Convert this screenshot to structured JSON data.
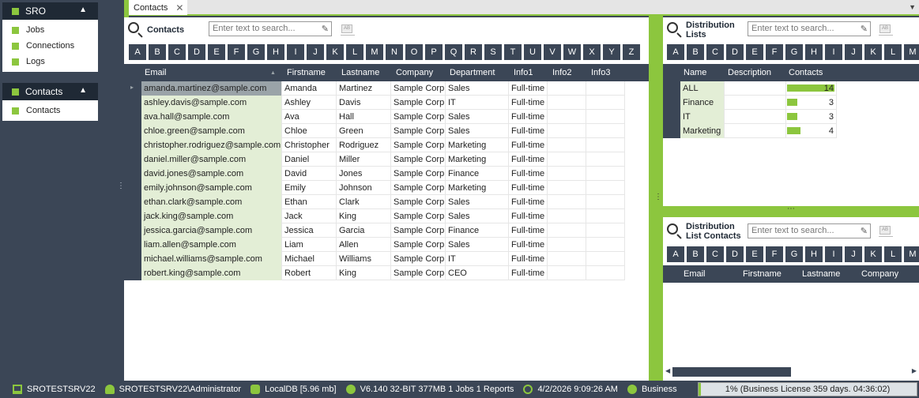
{
  "sidebar": {
    "groups": [
      {
        "title": "SRO",
        "items": [
          "Jobs",
          "Connections",
          "Logs"
        ]
      },
      {
        "title": "Contacts",
        "items": [
          "Contacts"
        ]
      }
    ]
  },
  "tabs": [
    {
      "label": "Contacts"
    }
  ],
  "contacts_panel": {
    "title": "Contacts",
    "search_placeholder": "Enter text to search...",
    "alphabet": [
      "A",
      "B",
      "C",
      "D",
      "E",
      "F",
      "G",
      "H",
      "I",
      "J",
      "K",
      "L",
      "M",
      "N",
      "O",
      "P",
      "Q",
      "R",
      "S",
      "T",
      "U",
      "V",
      "W",
      "X",
      "Y",
      "Z"
    ],
    "columns": [
      "Email",
      "Firstname",
      "Lastname",
      "Company",
      "Department",
      "Info1",
      "Info2",
      "Info3"
    ],
    "rows": [
      [
        "amanda.martinez@sample.com",
        "Amanda",
        "Martinez",
        "Sample Corp",
        "Sales",
        "Full-time",
        "",
        ""
      ],
      [
        "ashley.davis@sample.com",
        "Ashley",
        "Davis",
        "Sample Corp",
        "IT",
        "Full-time",
        "",
        ""
      ],
      [
        "ava.hall@sample.com",
        "Ava",
        "Hall",
        "Sample Corp",
        "Sales",
        "Full-time",
        "",
        ""
      ],
      [
        "chloe.green@sample.com",
        "Chloe",
        "Green",
        "Sample Corp",
        "Sales",
        "Full-time",
        "",
        ""
      ],
      [
        "christopher.rodriguez@sample.com",
        "Christopher",
        "Rodriguez",
        "Sample Corp",
        "Marketing",
        "Full-time",
        "",
        ""
      ],
      [
        "daniel.miller@sample.com",
        "Daniel",
        "Miller",
        "Sample Corp",
        "Marketing",
        "Full-time",
        "",
        ""
      ],
      [
        "david.jones@sample.com",
        "David",
        "Jones",
        "Sample Corp",
        "Finance",
        "Full-time",
        "",
        ""
      ],
      [
        "emily.johnson@sample.com",
        "Emily",
        "Johnson",
        "Sample Corp",
        "Marketing",
        "Full-time",
        "",
        ""
      ],
      [
        "ethan.clark@sample.com",
        "Ethan",
        "Clark",
        "Sample Corp",
        "Sales",
        "Full-time",
        "",
        ""
      ],
      [
        "jack.king@sample.com",
        "Jack",
        "King",
        "Sample Corp",
        "Sales",
        "Full-time",
        "",
        ""
      ],
      [
        "jessica.garcia@sample.com",
        "Jessica",
        "Garcia",
        "Sample Corp",
        "Finance",
        "Full-time",
        "",
        ""
      ],
      [
        "liam.allen@sample.com",
        "Liam",
        "Allen",
        "Sample Corp",
        "Sales",
        "Full-time",
        "",
        ""
      ],
      [
        "michael.williams@sample.com",
        "Michael",
        "Williams",
        "Sample Corp",
        "IT",
        "Full-time",
        "",
        ""
      ],
      [
        "robert.king@sample.com",
        "Robert",
        "King",
        "Sample Corp",
        "CEO",
        "Full-time",
        "",
        ""
      ]
    ]
  },
  "distribution_lists": {
    "title_line1": "Distribution",
    "title_line2": "Lists",
    "search_placeholder": "Enter text to search...",
    "alphabet": [
      "A",
      "B",
      "C",
      "D",
      "E",
      "F",
      "G",
      "H",
      "I",
      "J",
      "K",
      "L",
      "M"
    ],
    "columns": [
      "Name",
      "Description",
      "Contacts"
    ],
    "rows": [
      {
        "name": "ALL",
        "description": "",
        "contacts": 14
      },
      {
        "name": "Finance",
        "description": "",
        "contacts": 3
      },
      {
        "name": "IT",
        "description": "",
        "contacts": 3
      },
      {
        "name": "Marketing",
        "description": "",
        "contacts": 4
      }
    ]
  },
  "distribution_list_contacts": {
    "title_line1": "Distribution",
    "title_line2": "List Contacts",
    "search_placeholder": "Enter text to search...",
    "alphabet": [
      "A",
      "B",
      "C",
      "D",
      "E",
      "F",
      "G",
      "H",
      "I",
      "J",
      "K",
      "L",
      "M"
    ],
    "columns": [
      "Email",
      "Firstname",
      "Lastname",
      "Company"
    ]
  },
  "statusbar": {
    "server": "SROTESTSRV22",
    "user": "SROTESTSRV22\\Administrator",
    "db": "LocalDB [5.96 mb]",
    "version": "V6.140 32-BIT 377MB 1 Jobs 1 Reports",
    "datetime": "4/2/2026 9:09:26 AM",
    "edition": "Business",
    "license_text": "1% (Business License 359 days. 04:36:02)",
    "license_progress": 0.01
  },
  "colors": {
    "accent": "#8cc63e",
    "dark": "#3b4656",
    "darker": "#1f2935"
  }
}
